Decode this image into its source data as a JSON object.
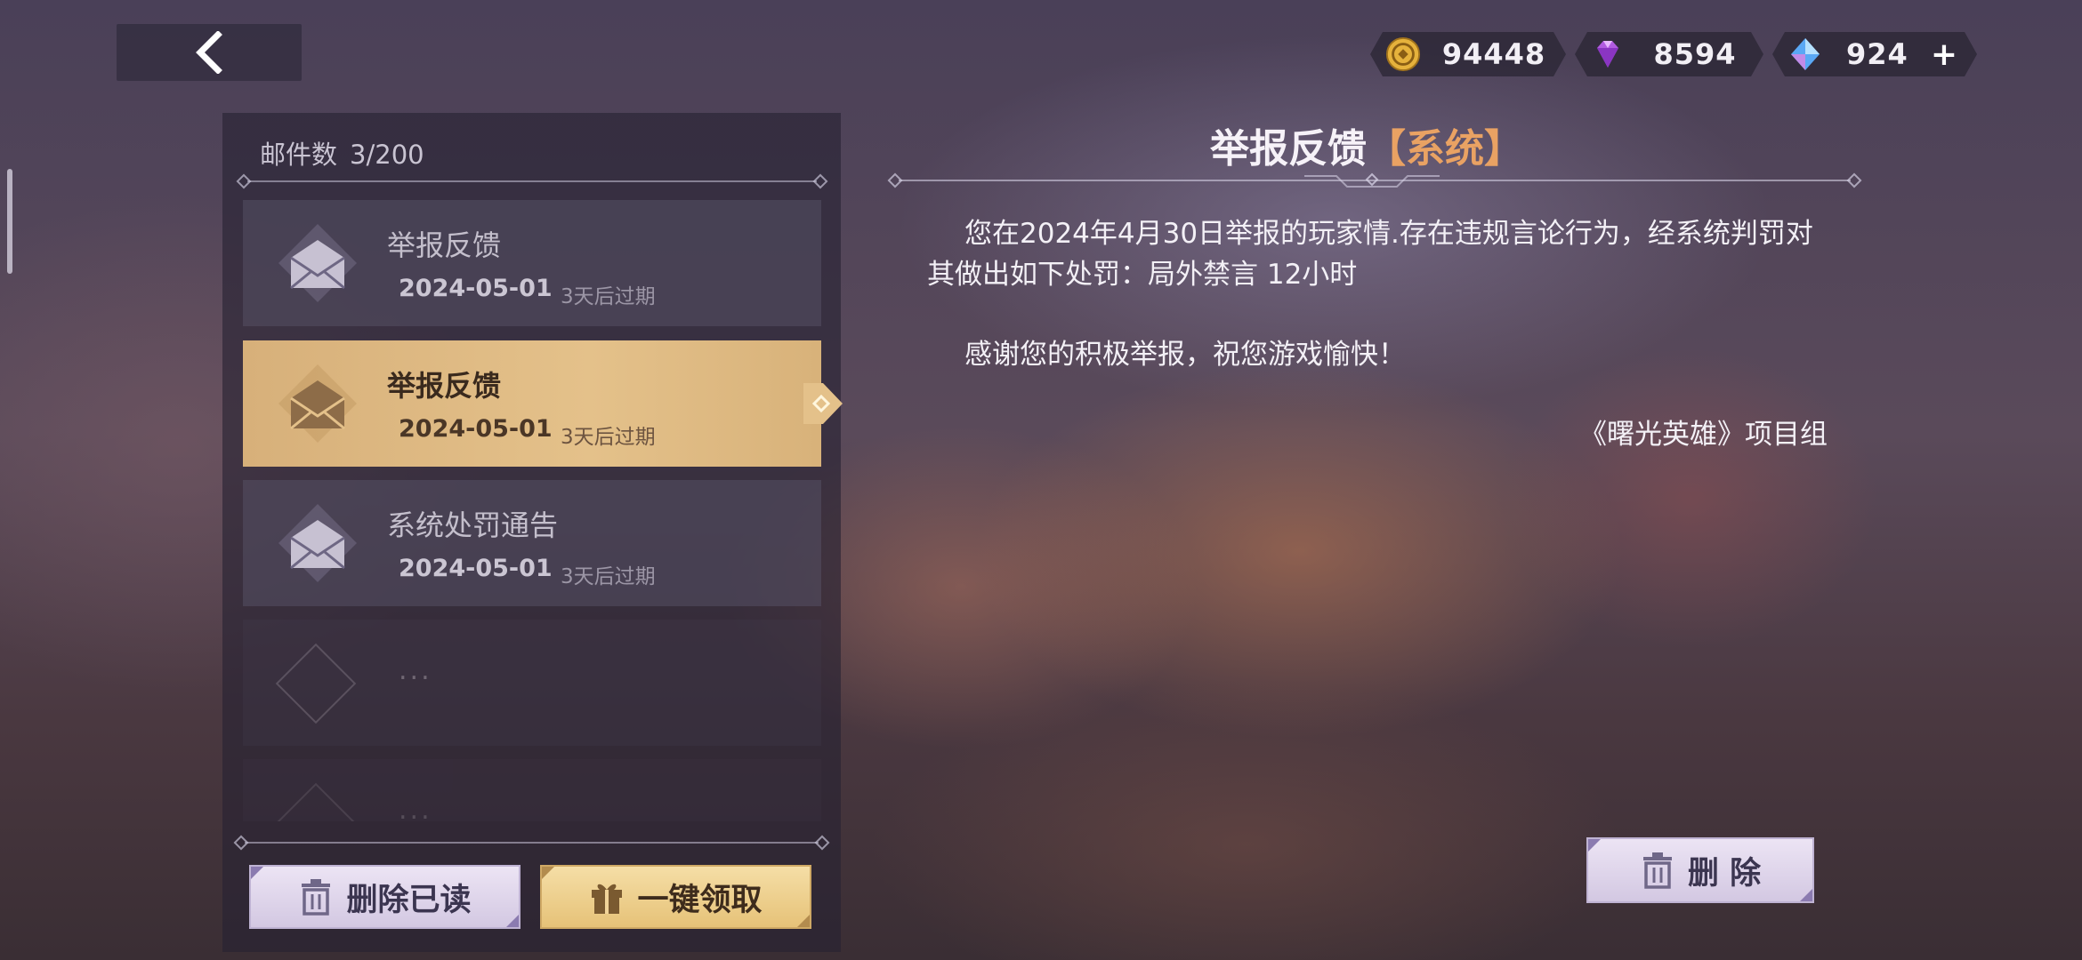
{
  "currencies": [
    {
      "icon": "gold-coin-icon",
      "value": "94448"
    },
    {
      "icon": "purple-diamond-icon",
      "value": "8594"
    },
    {
      "icon": "blue-crystal-icon",
      "value": "924",
      "plus": "+"
    }
  ],
  "mailbox": {
    "count_label": "邮件数",
    "count_value": "3/200",
    "mails": [
      {
        "title": "举报反馈",
        "date": "2024-05-01",
        "expire": "3天后过期"
      },
      {
        "title": "举报反馈",
        "date": "2024-05-01",
        "expire": "3天后过期"
      },
      {
        "title": "系统处罚通告",
        "date": "2024-05-01",
        "expire": "3天后过期"
      }
    ],
    "empty_placeholder": "...",
    "delete_read_label": "删除已读",
    "claim_all_label": "一键领取"
  },
  "detail": {
    "title": "举报反馈",
    "tag": "【系统】",
    "line1": "您在2024年4月30日举报的玩家情.存在违规言论行为，经系统判罚对",
    "line2": "其做出如下处罚：局外禁言 12小时",
    "line3": "感谢您的积极举报，祝您游戏愉快！",
    "signature": "《曙光英雄》项目组",
    "delete_label": "删 除"
  },
  "colors": {
    "accent_gold": "#e4c18a",
    "tag_orange": "#e9a263",
    "button_lilac": "#d3c8e2"
  }
}
